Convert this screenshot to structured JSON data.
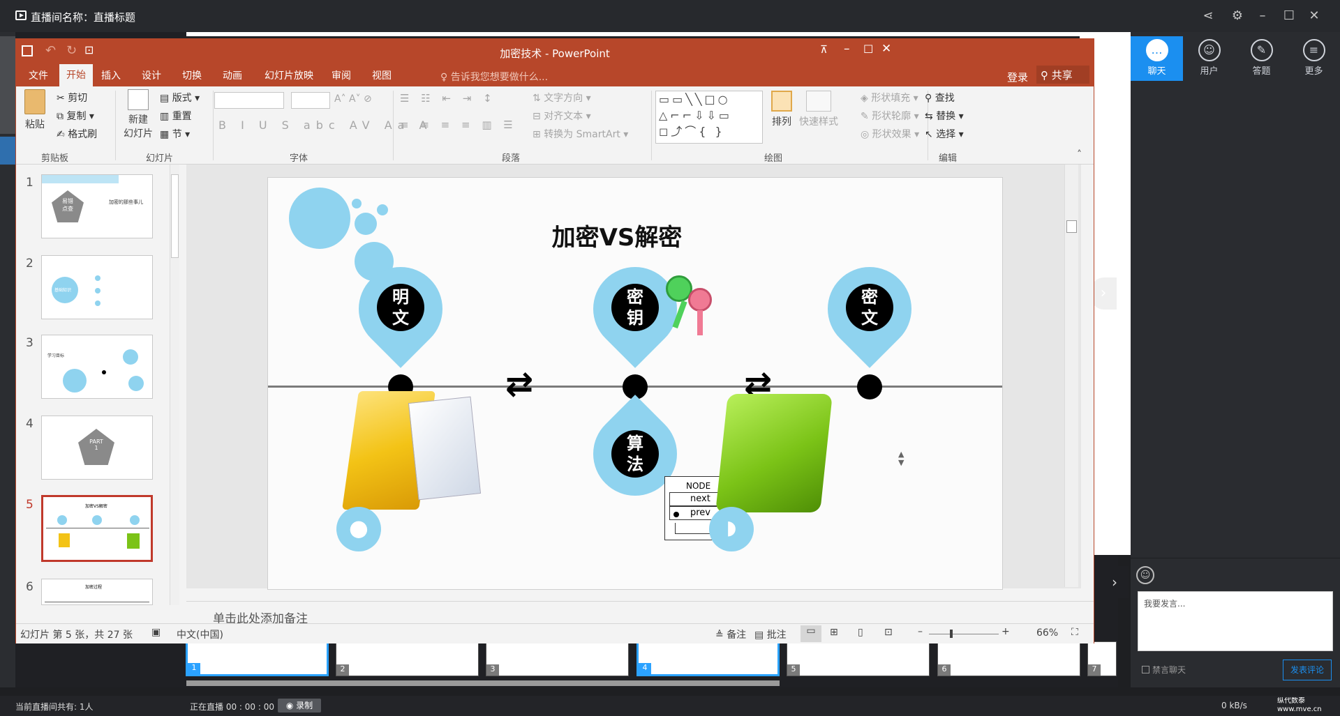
{
  "app": {
    "title": "直播间名称：直播标题",
    "viewers": "当前直播间共有: 1人",
    "live_status": "正在直播 00 : 00 : 00",
    "record_label": "录制",
    "net_speed": "0 kB/s",
    "watermark": "纵代数泰 www.mve.cn"
  },
  "right_panel": {
    "tabs": [
      {
        "label": "聊天",
        "icon": "chat-icon"
      },
      {
        "label": "用户",
        "icon": "users-icon"
      },
      {
        "label": "答题",
        "icon": "pen-icon"
      },
      {
        "label": "更多",
        "icon": "menu-icon"
      }
    ],
    "chat_placeholder": "我要发言...",
    "mute_label": "禁言聊天",
    "send_label": "发表评论"
  },
  "filmstrip": [
    "1",
    "2",
    "3",
    "4",
    "5",
    "6",
    "7"
  ],
  "ppt": {
    "window_title": "加密技术 - PowerPoint",
    "tabs": [
      "文件",
      "开始",
      "插入",
      "设计",
      "切换",
      "动画",
      "幻灯片放映",
      "审阅",
      "视图"
    ],
    "tell_me": "告诉我您想要做什么...",
    "login": "登录",
    "share": "共享",
    "ribbon": {
      "clipboard": {
        "paste": "粘贴",
        "cut": "剪切",
        "copy": "复制",
        "format_painter": "格式刷",
        "group": "剪贴板"
      },
      "slides": {
        "new_slide": "新建",
        "new_slide2": "幻灯片",
        "layout": "版式",
        "reset": "重置",
        "section": "节",
        "group": "幻灯片"
      },
      "font": {
        "group": "字体"
      },
      "paragraph": {
        "text_direction": "文字方向",
        "align_text": "对齐文本",
        "smartart": "转换为 SmartArt",
        "group": "段落"
      },
      "drawing": {
        "arrange": "排列",
        "quick_styles": "快速样式",
        "shape_fill": "形状填充",
        "shape_outline": "形状轮廓",
        "shape_effects": "形状效果",
        "group": "绘图"
      },
      "editing": {
        "find": "查找",
        "replace": "替换",
        "select": "选择",
        "group": "编辑"
      }
    },
    "slide_numbers": [
      "1",
      "2",
      "3",
      "4",
      "5",
      "6"
    ],
    "thumb_texts": {
      "t1_center": "易错\n点查",
      "t1_title": "加密的那些事儿",
      "t2_center": "基础知识",
      "t3_title": "学习目标",
      "t4": "PART\n1",
      "t5_title": "加密VS解密",
      "t6_title": "加密过程"
    },
    "slide": {
      "title": "加密VS解密",
      "pin1": "明\n文",
      "pin2": "密\n钥",
      "pin3": "密\n文",
      "pin4": "算\n法",
      "node_labels": [
        "NODE",
        "next",
        "prev"
      ]
    },
    "notes_placeholder": "单击此处添加备注",
    "status": {
      "slide_info": "幻灯片 第 5 张，共 27 张",
      "language": "中文(中国)",
      "notes": "备注",
      "comments": "批注",
      "zoom": "66%"
    }
  },
  "colors": {
    "ppt_accent": "#b7472a",
    "live_blue": "#1b8ff0",
    "pin_blue": "#8fd3ef"
  }
}
